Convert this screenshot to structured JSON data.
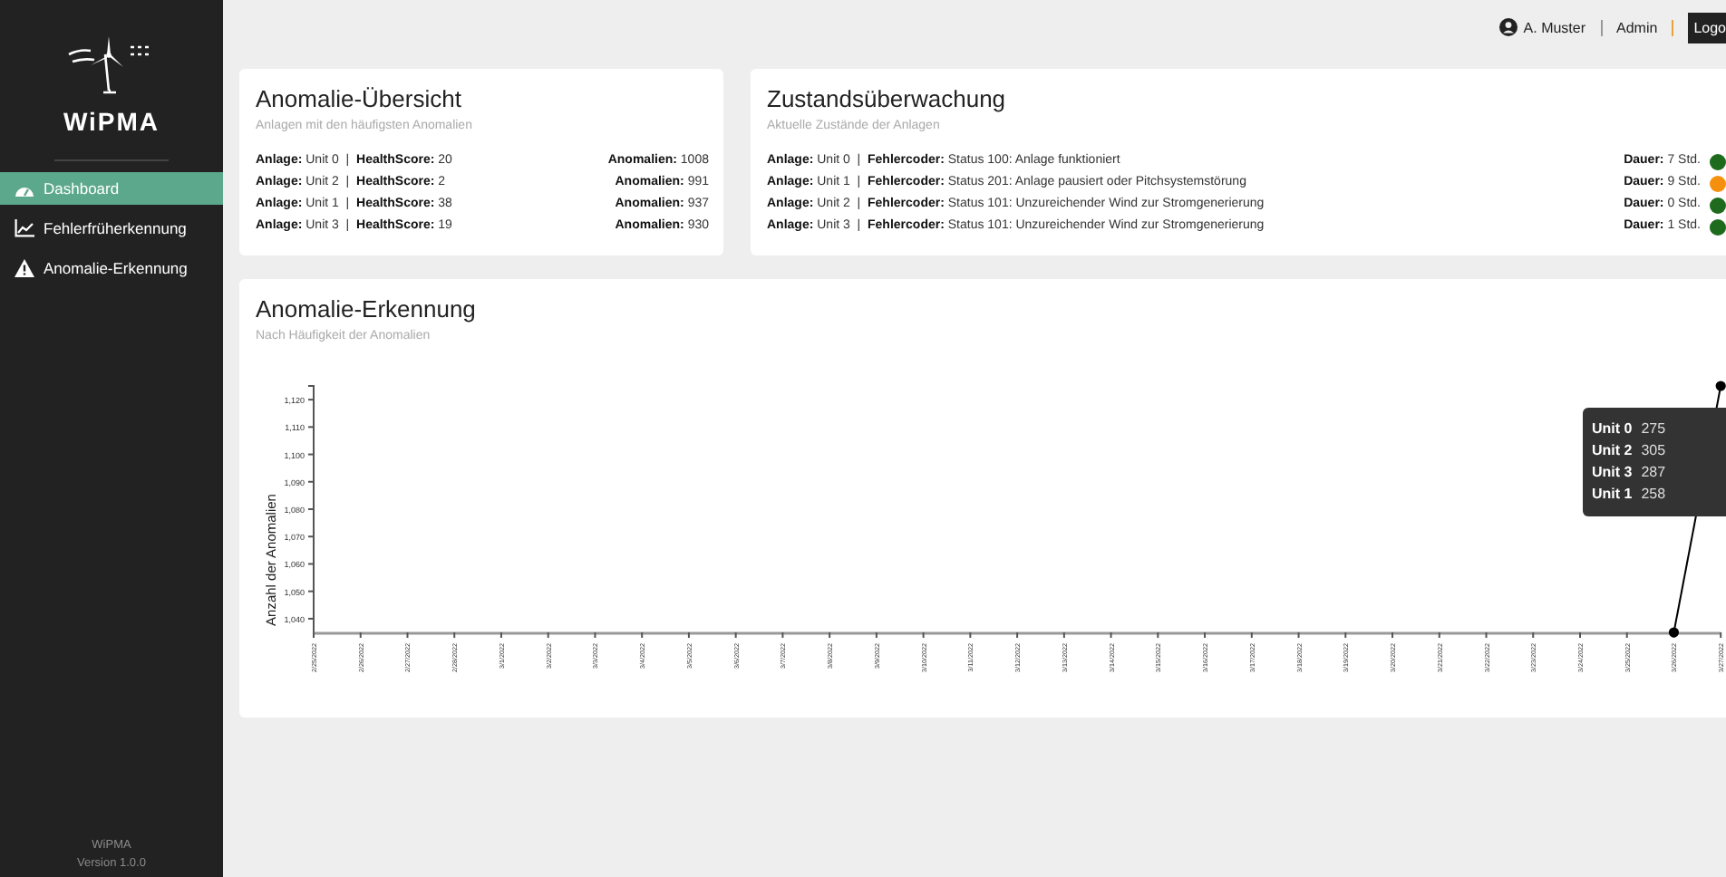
{
  "sidebar": {
    "brand": "WiPMA",
    "items": [
      {
        "label": "Dashboard",
        "kind": "gauge",
        "selected": true
      },
      {
        "label": "Fehlerfrüherkennung",
        "kind": "chart",
        "selected": false
      },
      {
        "label": "Anomalie-Erkennung",
        "kind": "warning",
        "selected": false
      }
    ],
    "footer": [
      "WiPMA",
      "Version 1.0.0"
    ]
  },
  "header": {
    "user": "A. Muster",
    "role": "Admin",
    "logout": "Logo"
  },
  "overview": {
    "title": "Anomalie-Übersicht",
    "subtitle": "Anlagen mit den häufigsten Anomalien",
    "rows": [
      {
        "left": "**Anlage:** Unit 0  |  **HealthScore:** 20",
        "right": "**Anomalien:** 1008"
      },
      {
        "left": "**Anlage:** Unit 2  |  **HealthScore:** 2",
        "right": "**Anomalien:** 991"
      },
      {
        "left": "**Anlage:** Unit 1  |  **HealthScore:** 38",
        "right": "**Anomalien:** 937"
      },
      {
        "left": "**Anlage:** Unit 3  |  **HealthScore:** 19",
        "right": "**Anomalien:** 930"
      }
    ]
  },
  "monitoring": {
    "title": "Zustandsüberwachung",
    "subtitle": "Aktuelle Zustände der Anlagen",
    "rows": [
      {
        "left": "**Anlage:** Unit 0  |  **Fehlercoder:** Status 100: Anlage funktioniert",
        "right": "**Dauer:** 7 Std.",
        "color": "#1e6b1e"
      },
      {
        "left": "**Anlage:** Unit 1  |  **Fehlercoder:** Status 201: Anlage pausiert oder Pitchsystemstörung",
        "right": "**Dauer:** 9 Std.",
        "color": "#f5900f"
      },
      {
        "left": "**Anlage:** Unit 2  |  **Fehlercoder:** Status 101: Unzureichender Wind zur Stromgenerierung",
        "right": "**Dauer:** 0 Std.",
        "color": "#1e6b1e"
      },
      {
        "left": "**Anlage:** Unit 3  |  **Fehlercoder:** Status 101: Unzureichender Wind zur Stromgenerierung",
        "right": "**Dauer:** 1 Std.",
        "color": "#1e6b1e"
      }
    ]
  },
  "detection": {
    "title": "Anomalie-Erkennung",
    "subtitle": "Nach Häufigkeit der Anomalien",
    "chart_data": {
      "type": "line",
      "ylabel": "Anzahl der Anomalien",
      "categories": [
        "2/25/2022",
        "2/26/2022",
        "2/27/2022",
        "2/28/2022",
        "3/1/2022",
        "3/2/2022",
        "3/3/2022",
        "3/4/2022",
        "3/5/2022",
        "3/6/2022",
        "3/7/2022",
        "3/8/2022",
        "3/9/2022",
        "3/10/2022",
        "3/11/2022",
        "3/12/2022",
        "3/13/2022",
        "3/14/2022",
        "3/15/2022",
        "3/16/2022",
        "3/17/2022",
        "3/18/2022",
        "3/19/2022",
        "3/20/2022",
        "3/21/2022",
        "3/22/2022",
        "3/23/2022",
        "3/24/2022",
        "3/25/2022",
        "3/26/2022",
        "3/27/2022"
      ],
      "series": [
        {
          "color": "#000000",
          "marker": "circle",
          "values": [
            null,
            null,
            null,
            null,
            null,
            null,
            null,
            null,
            null,
            null,
            null,
            null,
            null,
            null,
            null,
            null,
            null,
            null,
            null,
            null,
            null,
            null,
            null,
            null,
            null,
            null,
            null,
            null,
            null,
            1035,
            1125
          ]
        }
      ],
      "ylim": [
        1035,
        1125
      ],
      "yticks": [
        {
          "value": 1040,
          "label": "1,040"
        },
        {
          "value": 1050,
          "label": "1,050"
        },
        {
          "value": 1060,
          "label": "1,060"
        },
        {
          "value": 1070,
          "label": "1,070"
        },
        {
          "value": 1080,
          "label": "1,080"
        },
        {
          "value": 1090,
          "label": "1,090"
        },
        {
          "value": 1100,
          "label": "1,100"
        },
        {
          "value": 1110,
          "label": "1,110"
        },
        {
          "value": 1120,
          "label": "1,120"
        }
      ]
    },
    "tooltip": [
      {
        "label": "Unit 0",
        "value": "275"
      },
      {
        "label": "Unit 2",
        "value": "305"
      },
      {
        "label": "Unit 3",
        "value": "287"
      },
      {
        "label": "Unit 1",
        "value": "258"
      }
    ]
  }
}
